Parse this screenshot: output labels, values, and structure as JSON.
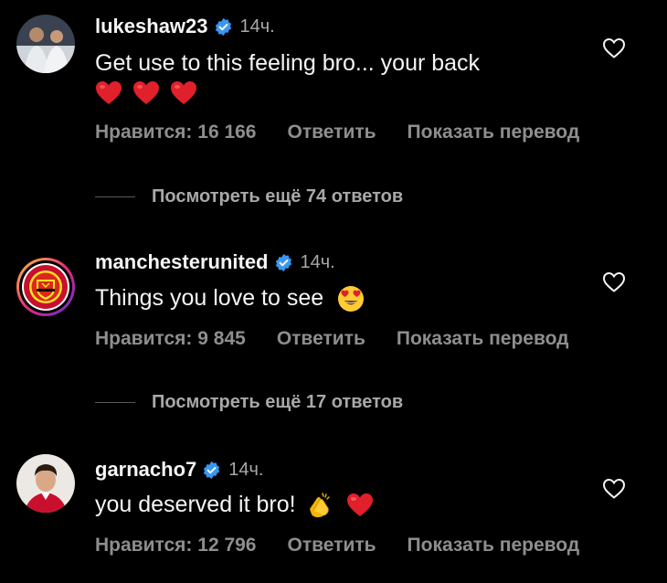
{
  "colors": {
    "background": "#000000",
    "primary_text": "#f5f5f5",
    "secondary_text": "#8e8e8e",
    "verified_blue": "#3897f0",
    "heart_red": "#e0202a"
  },
  "comments": [
    {
      "username": "lukeshaw23",
      "verified": true,
      "time": "14ч.",
      "text": "Get use to this feeling bro... your back",
      "emojis": [
        "red-heart",
        "red-heart",
        "red-heart"
      ],
      "likes_label": "Нравится: 16 166",
      "reply_label": "Ответить",
      "translate_label": "Показать перевод",
      "view_replies": "Посмотреть ещё 74 ответов"
    },
    {
      "username": "manchesterunited",
      "verified": true,
      "time": "14ч.",
      "text": "Things you love to see",
      "emojis": [
        "heart-eyes"
      ],
      "likes_label": "Нравится: 9 845",
      "reply_label": "Ответить",
      "translate_label": "Показать перевод",
      "view_replies": "Посмотреть ещё 17 ответов"
    },
    {
      "username": "garnacho7",
      "verified": true,
      "time": "14ч.",
      "text": "you deserved it bro!",
      "emojis": [
        "clapping-hands",
        "red-heart"
      ],
      "likes_label": "Нравится: 12 796",
      "reply_label": "Ответить",
      "translate_label": "Показать перевод"
    }
  ]
}
